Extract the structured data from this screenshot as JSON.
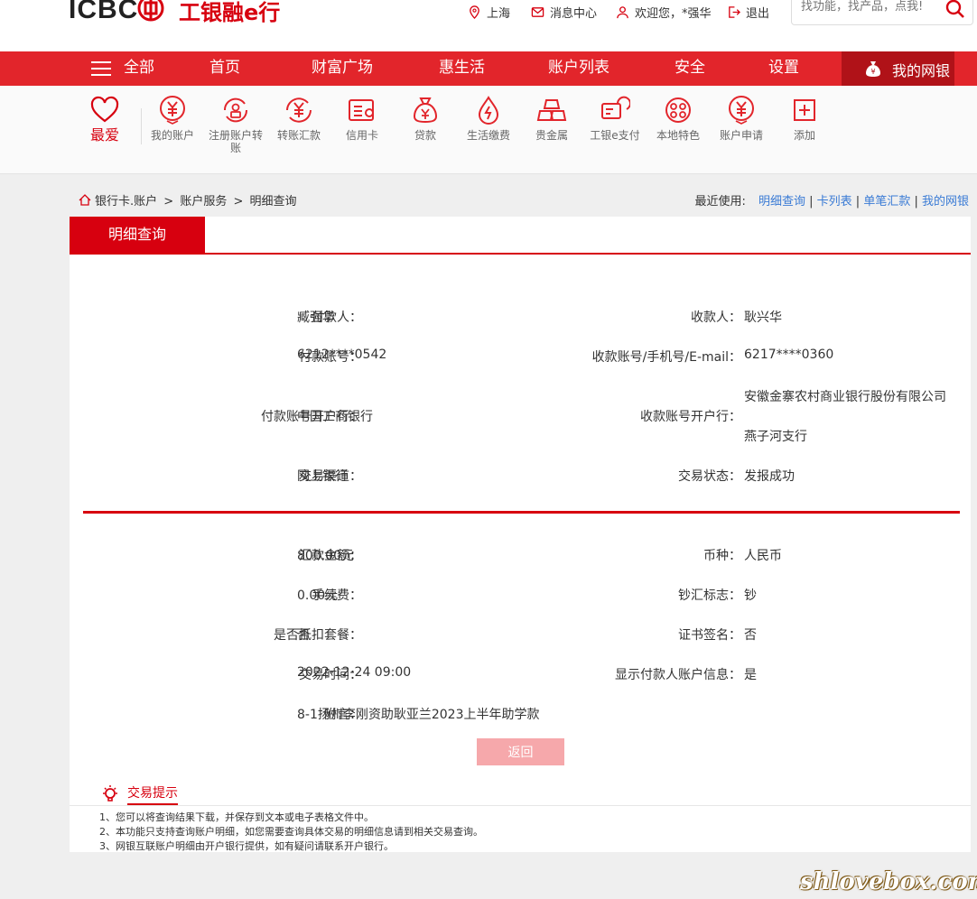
{
  "header": {
    "logo_icbc": "ICBC",
    "logo_text": "工银融e行",
    "location": "上海",
    "messages": "消息中心",
    "welcome": "欢迎您，*强华",
    "logout": "退出",
    "search_placeholder": "找功能，找产品，点我!"
  },
  "nav": {
    "all": "全部",
    "items": [
      "首页",
      "财富广场",
      "惠生活",
      "账户列表",
      "安全",
      "设置"
    ],
    "mybank": "我的网银"
  },
  "quick": {
    "fav": "最爱",
    "items": [
      {
        "label": "我的账户",
        "icon": "yuan-circle-icon"
      },
      {
        "label": "注册账户转账",
        "icon": "register-transfer-icon"
      },
      {
        "label": "转账汇款",
        "icon": "transfer-icon"
      },
      {
        "label": "信用卡",
        "icon": "credit-card-icon"
      },
      {
        "label": "贷款",
        "icon": "money-bag-icon"
      },
      {
        "label": "生活缴费",
        "icon": "drop-icon"
      },
      {
        "label": "贵金属",
        "icon": "gold-bars-icon"
      },
      {
        "label": "工银e支付",
        "icon": "e-pay-icon"
      },
      {
        "label": "本地特色",
        "icon": "local-icon"
      },
      {
        "label": "账户申请",
        "icon": "account-apply-icon"
      },
      {
        "label": "添加",
        "icon": "plus-icon"
      }
    ]
  },
  "breadcrumb": {
    "items": [
      "银行卡.账户",
      ">",
      "账户服务",
      ">",
      "明细查询"
    ]
  },
  "recent": {
    "label": "最近使用:",
    "links": [
      "明细查询",
      "卡列表",
      "单笔汇款",
      "我的网银"
    ]
  },
  "panel": {
    "tab": "明细查询",
    "payer_label": "付款人：",
    "payer": "臧强华",
    "payee_label": "收款人：",
    "payee": "耿兴华",
    "payer_acct_label": "付款账号：",
    "payer_acct": "6212****0542",
    "payee_acct_label": "收款账号/手机号/E-mail：",
    "payee_acct": "6217****0360",
    "payer_bank_label": "付款账号开户行：",
    "payer_bank": "中国工商银行",
    "payee_bank_label": "收款账号开户行：",
    "payee_bank_line1": "安徽金寨农村商业银行股份有限公司",
    "payee_bank_line2": "燕子河支行",
    "channel_label": "交易渠道：",
    "channel": "网上银行",
    "status_label": "交易状态：",
    "status": "发报成功",
    "amount_label": "汇款金额：",
    "amount": "800.00元",
    "currency_label": "币种：",
    "currency": "人民币",
    "fee_label": "手续费：",
    "fee": "0.00元",
    "cash_label": "钞汇标志：",
    "cash": "钞",
    "package_label": "是否抵扣套餐：",
    "package": "否",
    "cert_label": "证书签名：",
    "cert": "否",
    "time_label": "交易时间：",
    "time": "2022-12-24 09:00",
    "show_payer_label": "显示付款人账户信息：",
    "show_payer": "是",
    "note_label": "附言：",
    "note": "8-1扬州李刚资助耿亚兰2023上半年助学款",
    "back": "返回"
  },
  "tips": {
    "title": "交易提示",
    "items": [
      "1、您可以将查询结果下载，并保存到文本或电子表格文件中。",
      "2、本功能只支持查询账户明细，如您需要查询具体交易的明细信息请到相关交易查询。",
      "3、网银互联账户明细由开户银行提供，如有疑问请联系开户银行。"
    ]
  },
  "watermark": "shlovebox.com",
  "colors": {
    "brand_red": "#d7000f",
    "nav_red": "#e2252b",
    "link_blue": "#3a7bd5"
  }
}
